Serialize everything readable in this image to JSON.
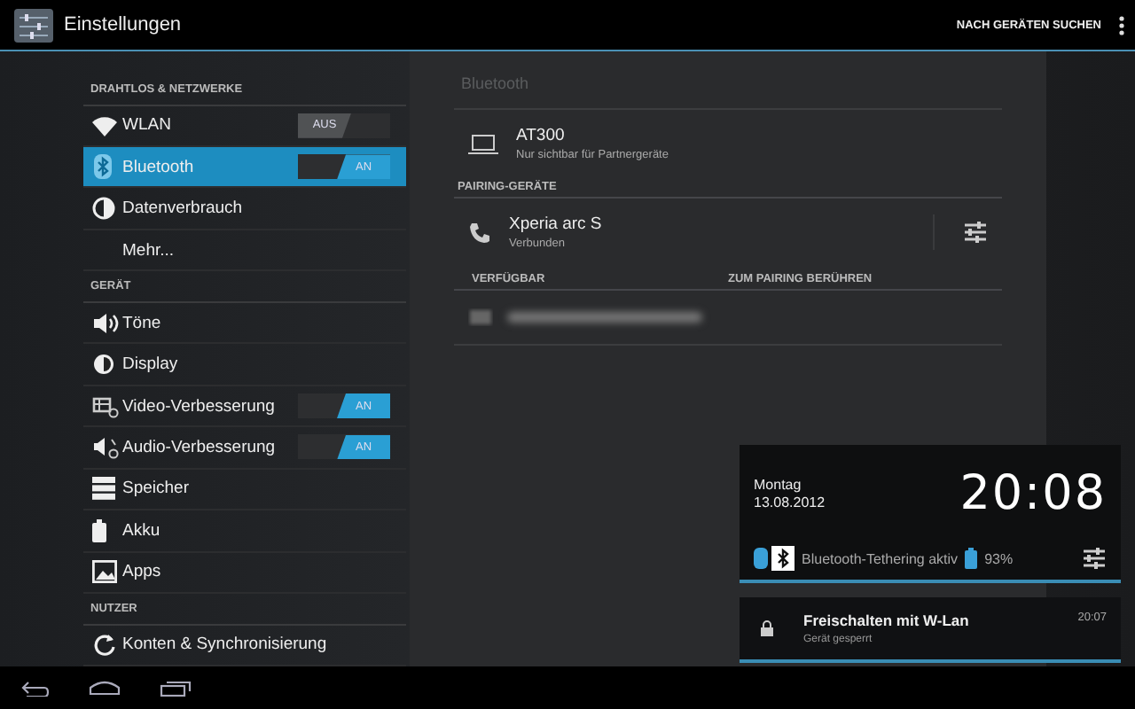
{
  "app_bar": {
    "title": "Einstellungen",
    "action": "NACH GERÄTEN SUCHEN"
  },
  "sidebar": {
    "items": [
      {
        "kind": "header",
        "label": "DRAHTLOS & NETZWERKE"
      },
      {
        "kind": "toggle",
        "label": "WLAN",
        "selected": false,
        "toggle": {
          "label": "AUS",
          "on": false
        }
      },
      {
        "kind": "toggle",
        "label": "Bluetooth",
        "selected": true,
        "toggle": {
          "label": "AN",
          "on": true
        }
      },
      {
        "kind": "item",
        "label": "Datenverbrauch",
        "selected": false
      },
      {
        "kind": "item",
        "label": "Mehr...",
        "selected": false
      },
      {
        "kind": "header",
        "label": "GERÄT"
      },
      {
        "kind": "item",
        "label": "Töne",
        "selected": false
      },
      {
        "kind": "item",
        "label": "Display",
        "selected": false
      },
      {
        "kind": "toggle",
        "label": "Video-Verbesserung",
        "selected": false,
        "toggle": {
          "label": "AN",
          "on": true
        }
      },
      {
        "kind": "toggle",
        "label": "Audio-Verbesserung",
        "selected": false,
        "toggle": {
          "label": "AN",
          "on": true
        }
      },
      {
        "kind": "item",
        "label": "Speicher",
        "selected": false
      },
      {
        "kind": "item",
        "label": "Akku",
        "selected": false
      },
      {
        "kind": "item",
        "label": "Apps",
        "selected": false
      },
      {
        "kind": "header",
        "label": "NUTZER"
      },
      {
        "kind": "item",
        "label": "Konten & Synchronisierung",
        "selected": false
      }
    ]
  },
  "detail": {
    "title": "Bluetooth",
    "this_device": {
      "name": "AT300",
      "status": "Nur sichtbar für Partnergeräte"
    },
    "paired_header": "PAIRING-GERÄTE",
    "paired": [
      {
        "name": "Xperia arc S",
        "status": "Verbunden"
      }
    ],
    "available_header": "VERFÜGBAR",
    "available_hint": "ZUM PAIRING BERÜHREN"
  },
  "notification_panel": {
    "day": "Montag",
    "date": "13.08.2012",
    "time": "20:08",
    "status": "Bluetooth-Tethering aktiv",
    "battery": "93%",
    "notifications": [
      {
        "title": "Freischalten mit W-Lan",
        "text": "Gerät gesperrt",
        "time": "20:07"
      }
    ]
  }
}
